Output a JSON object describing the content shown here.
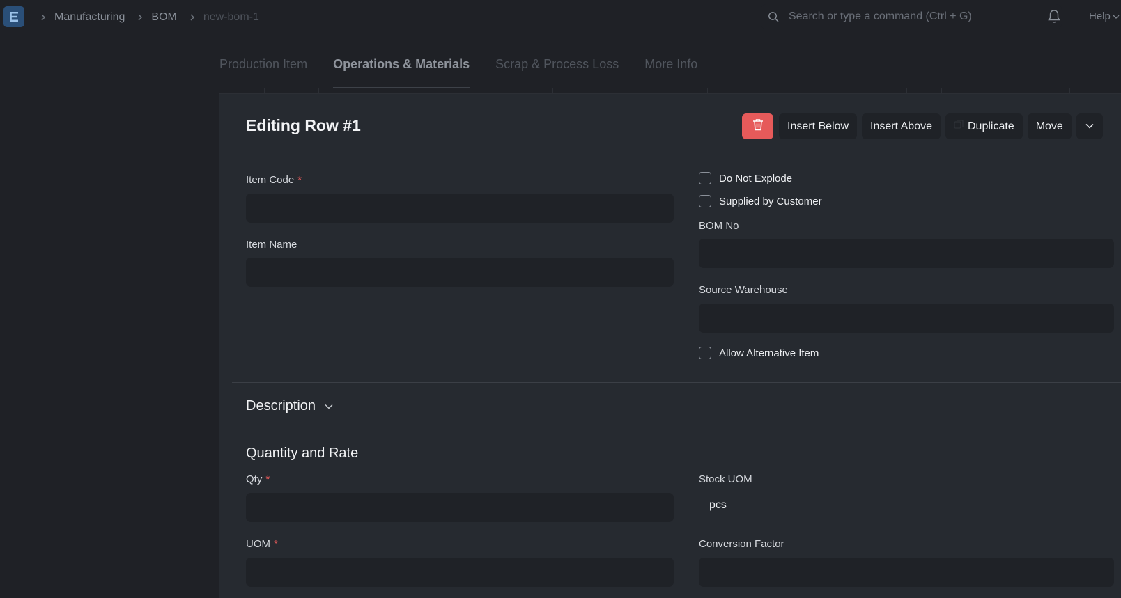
{
  "app": {
    "logo_icon": "frappe-e-logo"
  },
  "breadcrumb": {
    "items": [
      "Manufacturing",
      "BOM",
      "new-bom-1"
    ]
  },
  "search": {
    "placeholder": "Search or type a command (Ctrl + G)"
  },
  "help": {
    "label": "Help"
  },
  "tabs": [
    {
      "label": "Production Item",
      "active": false
    },
    {
      "label": "Operations & Materials",
      "active": true
    },
    {
      "label": "Scrap & Process Loss",
      "active": false
    },
    {
      "label": "More Info",
      "active": false
    }
  ],
  "editor": {
    "title": "Editing Row #1",
    "actions": {
      "insert_below": "Insert Below",
      "insert_above": "Insert Above",
      "duplicate": "Duplicate",
      "move": "Move"
    },
    "fields": {
      "item_code": {
        "label": "Item Code",
        "value": ""
      },
      "item_name": {
        "label": "Item Name",
        "value": ""
      },
      "do_not_explode": {
        "label": "Do Not Explode",
        "checked": false
      },
      "supplied_by_customer": {
        "label": "Supplied by Customer",
        "checked": false
      },
      "bom_no": {
        "label": "BOM No",
        "value": ""
      },
      "source_warehouse": {
        "label": "Source Warehouse",
        "value": ""
      },
      "allow_alternative_item": {
        "label": "Allow Alternative Item",
        "checked": false
      }
    },
    "sections": {
      "description": "Description",
      "quantity_and_rate": "Quantity and Rate"
    },
    "quantity": {
      "qty": {
        "label": "Qty",
        "value": ""
      },
      "stock_uom": {
        "label": "Stock UOM",
        "value": "pcs"
      },
      "uom": {
        "label": "UOM",
        "value": ""
      },
      "conversion_factor": {
        "label": "Conversion Factor",
        "value": ""
      }
    }
  },
  "colors": {
    "danger": "#e65a5a",
    "logo_bg": "#2a4f78",
    "panel_bg": "#262a30",
    "page_bg": "#1f2126"
  }
}
